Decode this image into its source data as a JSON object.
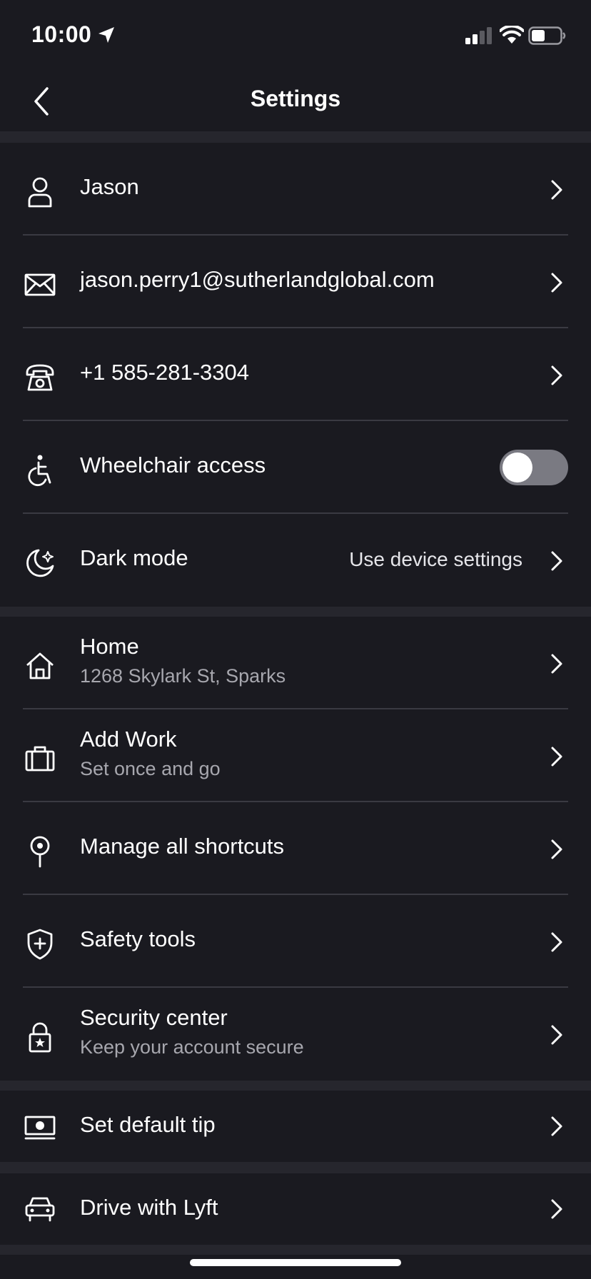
{
  "status_bar": {
    "time": "10:00"
  },
  "nav": {
    "title": "Settings"
  },
  "rows": [
    {
      "title": "Jason",
      "icon": "person-icon"
    },
    {
      "title": "jason.perry1@sutherlandglobal.com",
      "icon": "mail-icon"
    },
    {
      "title": "+1 585-281-3304",
      "icon": "phone-icon"
    },
    {
      "title": "Wheelchair access",
      "icon": "wheelchair-icon",
      "toggle_on": false
    },
    {
      "title": "Dark mode",
      "value": "Use device settings",
      "icon": "moon-icon"
    },
    {
      "title": "Home",
      "subtitle": "1268 Skylark St, Sparks",
      "icon": "home-icon"
    },
    {
      "title": "Add Work",
      "subtitle": "Set once and go",
      "icon": "briefcase-icon"
    },
    {
      "title": "Manage all shortcuts",
      "icon": "pin-icon"
    },
    {
      "title": "Safety tools",
      "icon": "shield-icon"
    },
    {
      "title": "Security center",
      "subtitle": "Keep your account secure",
      "icon": "lock-icon"
    },
    {
      "title": "Set default tip",
      "icon": "cash-icon"
    },
    {
      "title": "Drive with Lyft",
      "icon": "car-icon"
    }
  ],
  "colors": {
    "background": "#1a1a20",
    "section_gap": "#26262d",
    "divider": "#3a3a42",
    "subtitle": "#a7a7ae",
    "toggle_off": "#7a7a82"
  }
}
